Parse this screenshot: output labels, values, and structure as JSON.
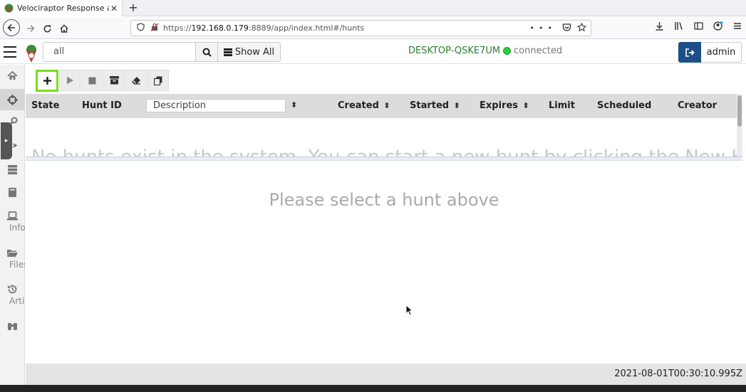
{
  "browser": {
    "tab_title": "Velociraptor Response an",
    "url_prefix": "https://",
    "url_host": "192.168.0.179",
    "url_rest": ":8889/app/index.html#/hunts"
  },
  "header": {
    "search_value": "all",
    "show_all_label": "Show All",
    "hostname": "DESKTOP-QSKE7UM",
    "status": "connected",
    "user": "admin"
  },
  "sidebar": {
    "items": [
      {
        "name": "home",
        "label": ""
      },
      {
        "name": "hunt-manager",
        "label": ""
      },
      {
        "name": "server-artifacts",
        "label": ""
      },
      {
        "name": "notebooks-view",
        "label": ""
      },
      {
        "name": "events",
        "label": ""
      },
      {
        "name": "notebooks",
        "label": ""
      },
      {
        "name": "host-info",
        "label": "Info"
      },
      {
        "name": "files",
        "label": "Files"
      },
      {
        "name": "artifacts",
        "label": "Artifacts"
      },
      {
        "name": "search",
        "label": ""
      }
    ]
  },
  "table": {
    "columns": {
      "state": "State",
      "hunt_id": "Hunt ID",
      "description": "Description",
      "created": "Created",
      "started": "Started",
      "expires": "Expires",
      "limit": "Limit",
      "scheduled": "Scheduled",
      "creator": "Creator"
    },
    "empty_message": "No hunts exist in the system. You can start a new hunt by clicking the New Hunt"
  },
  "detail": {
    "placeholder": "Please select a hunt above"
  },
  "footer": {
    "timestamp": "2021-08-01T00:30:10.995Z"
  },
  "colors": {
    "accent_green": "#7ddb22",
    "logout_blue": "#1c4f8a",
    "host_green": "#2e7d32"
  }
}
